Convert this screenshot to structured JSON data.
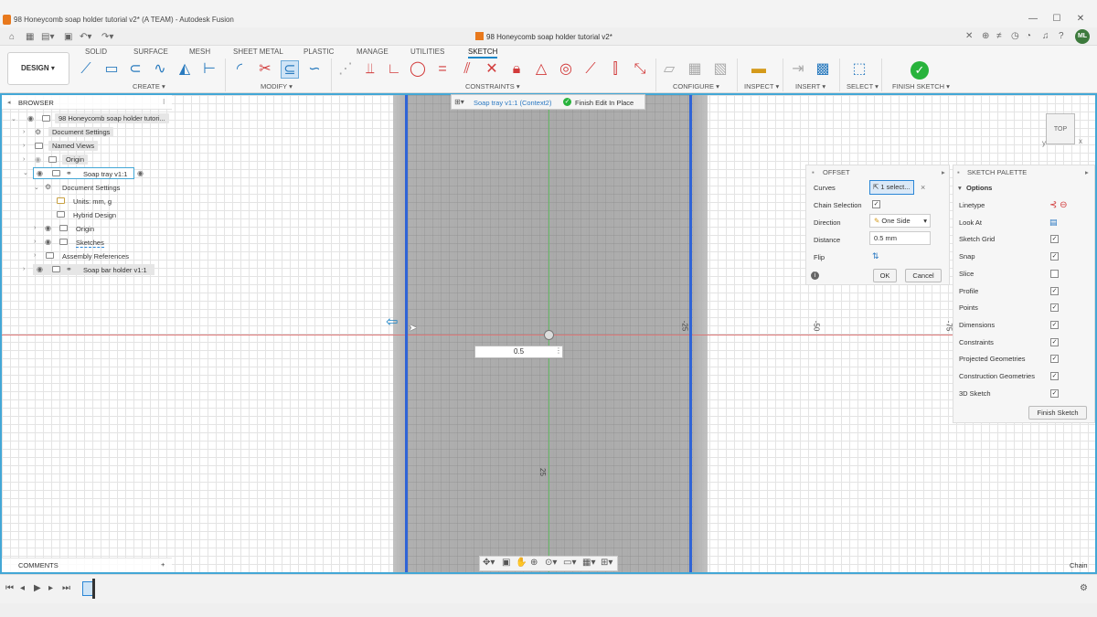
{
  "window": {
    "title": "98 Honeycomb soap holder tutorial v2* (A TEAM) - Autodesk Fusion",
    "minimize": "—",
    "maximize": "☐",
    "close": "✕"
  },
  "document_tab": {
    "title": "98 Honeycomb soap holder tutorial v2*",
    "close": "✕"
  },
  "user": {
    "initials": "ML"
  },
  "toolbar": {
    "workspace": "DESIGN ▾",
    "tabs": [
      "SOLID",
      "SURFACE",
      "MESH",
      "SHEET METAL",
      "PLASTIC",
      "MANAGE",
      "UTILITIES",
      "SKETCH"
    ],
    "active_tab": "SKETCH",
    "groups": {
      "create": "CREATE ▾",
      "modify": "MODIFY ▾",
      "constraints": "CONSTRAINTS ▾",
      "configure": "CONFIGURE ▾",
      "inspect": "INSPECT ▾",
      "insert": "INSERT ▾",
      "select": "SELECT ▾",
      "finish": "FINISH SKETCH ▾"
    }
  },
  "browser": {
    "header": "BROWSER",
    "root": "98 Honeycomb soap holder tutori...",
    "items": {
      "document_settings": "Document Settings",
      "named_views": "Named Views",
      "origin": "Origin",
      "soap_tray": "Soap tray v1:1",
      "sub_document_settings": "Document Settings",
      "units": "Units: mm, g",
      "hybrid_design": "Hybrid Design",
      "sub_origin": "Origin",
      "sketches": "Sketches",
      "assembly_references": "Assembly References",
      "soap_bar_holder": "Soap bar holder v1:1"
    }
  },
  "comments": {
    "label": "COMMENTS",
    "add": "+"
  },
  "context_bar": {
    "component": "Soap tray v1:1 (Context2)",
    "finish": "Finish Edit In Place"
  },
  "canvas": {
    "dimension_value": "0.5",
    "ticks": {
      "left_minus_25": "-25",
      "minus_50": "-50",
      "minus_75": "-75",
      "y_25": "25"
    }
  },
  "offset_panel": {
    "title": "OFFSET",
    "curves_label": "Curves",
    "curves_value": "1 select...",
    "chain_label": "Chain Selection",
    "chain_checked": true,
    "direction_label": "Direction",
    "direction_value": "One Side",
    "distance_label": "Distance",
    "distance_value": "0.5 mm",
    "flip_label": "Flip",
    "ok": "OK",
    "cancel": "Cancel"
  },
  "sketch_palette": {
    "title": "SKETCH PALETTE",
    "options_header": "Options",
    "rows": [
      {
        "label": "Linetype",
        "type": "icons"
      },
      {
        "label": "Look At",
        "type": "icon"
      },
      {
        "label": "Sketch Grid",
        "checked": true
      },
      {
        "label": "Snap",
        "checked": true
      },
      {
        "label": "Slice",
        "checked": false
      },
      {
        "label": "Profile",
        "checked": true
      },
      {
        "label": "Points",
        "checked": true
      },
      {
        "label": "Dimensions",
        "checked": true
      },
      {
        "label": "Constraints",
        "checked": true
      },
      {
        "label": "Projected Geometries",
        "checked": true
      },
      {
        "label": "Construction Geometries",
        "checked": true
      },
      {
        "label": "3D Sketch",
        "checked": true
      }
    ],
    "finish_button": "Finish Sketch"
  },
  "status": {
    "mode": "Chain"
  },
  "viewcube": {
    "face": "TOP"
  }
}
